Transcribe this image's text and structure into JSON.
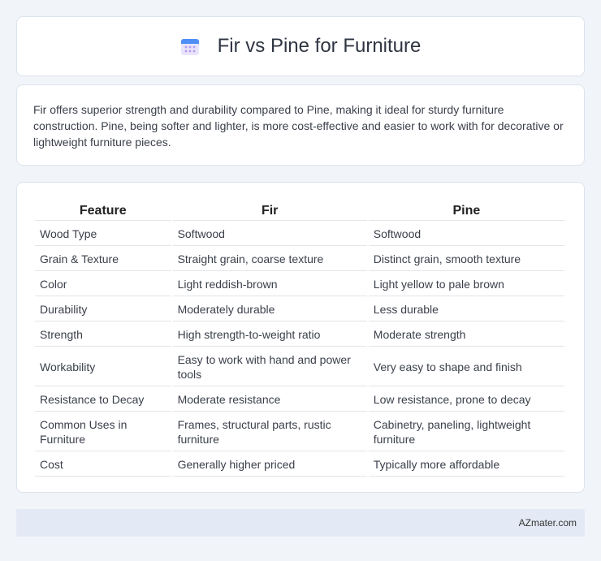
{
  "header": {
    "title": "Fir vs Pine for Furniture",
    "icon": "calendar-icon"
  },
  "summary": "Fir offers superior strength and durability compared to Pine, making it ideal for sturdy furniture construction. Pine, being softer and lighter, is more cost-effective and easier to work with for decorative or lightweight furniture pieces.",
  "table": {
    "headers": [
      "Feature",
      "Fir",
      "Pine"
    ],
    "rows": [
      [
        "Wood Type",
        "Softwood",
        "Softwood"
      ],
      [
        "Grain & Texture",
        "Straight grain, coarse texture",
        "Distinct grain, smooth texture"
      ],
      [
        "Color",
        "Light reddish-brown",
        "Light yellow to pale brown"
      ],
      [
        "Durability",
        "Moderately durable",
        "Less durable"
      ],
      [
        "Strength",
        "High strength-to-weight ratio",
        "Moderate strength"
      ],
      [
        "Workability",
        "Easy to work with hand and power tools",
        "Very easy to shape and finish"
      ],
      [
        "Resistance to Decay",
        "Moderate resistance",
        "Low resistance, prone to decay"
      ],
      [
        "Common Uses in Furniture",
        "Frames, structural parts, rustic furniture",
        "Cabinetry, paneling, lightweight furniture"
      ],
      [
        "Cost",
        "Generally higher priced",
        "Typically more affordable"
      ]
    ]
  },
  "footer": {
    "brand": "AZmater.com"
  }
}
